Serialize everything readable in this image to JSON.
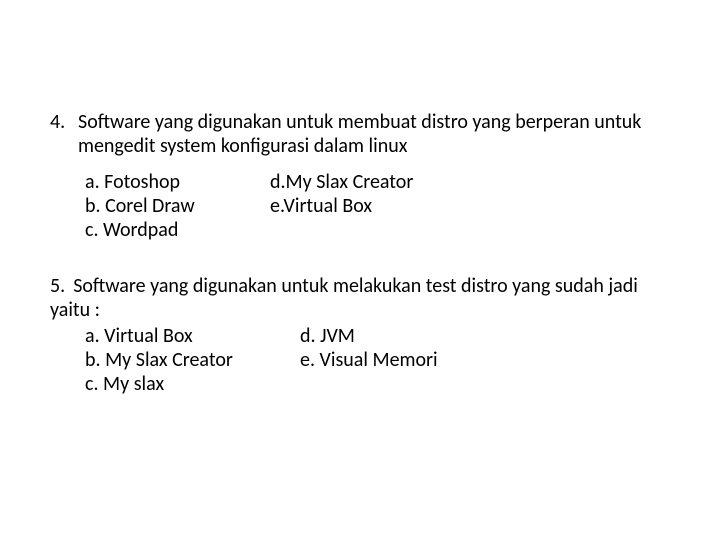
{
  "q4": {
    "number": "4.",
    "text": "Software yang digunakan untuk membuat  distro yang berperan untuk  mengedit system konfigurasi  dalam linux",
    "options": {
      "a": "a. Fotoshop",
      "b": "b. Corel Draw",
      "c": "c. Wordpad",
      "d": "d.My Slax Creator",
      "e": "e.Virtual Box"
    }
  },
  "q5": {
    "number": "5.",
    "text": "Software yang digunakan untuk melakukan test distro   yang sudah jadi yaitu :",
    "options": {
      "a": "a. Virtual Box",
      "b": "b. My Slax Creator",
      "c": "c. My slax",
      "d": "d. JVM",
      "e": "e. Visual Memori"
    }
  }
}
